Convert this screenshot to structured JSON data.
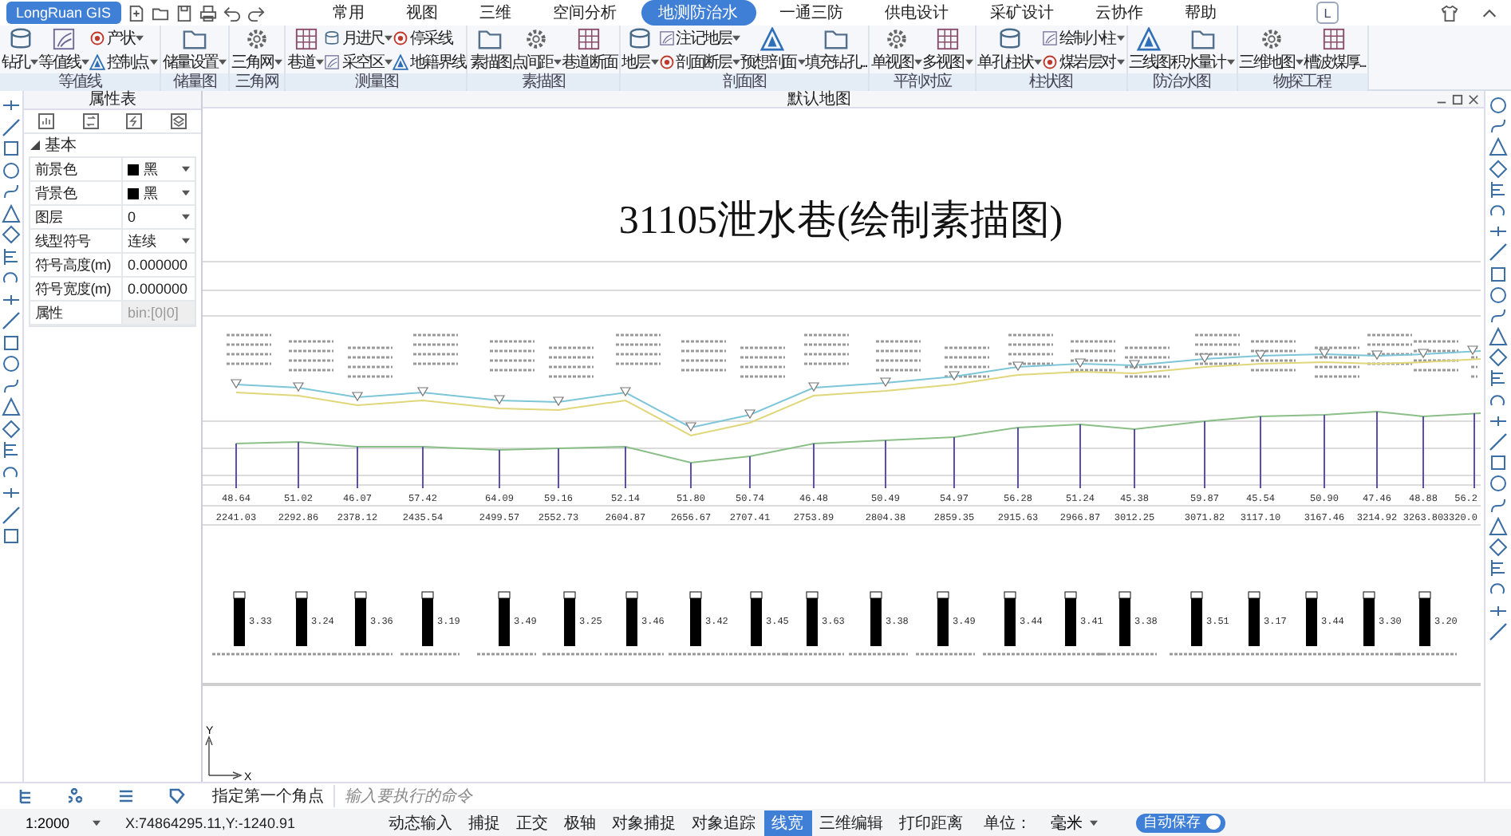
{
  "app": {
    "logo": "LongRuan GIS"
  },
  "menu": [
    {
      "label": "常用",
      "selected": false
    },
    {
      "label": "视图",
      "selected": false
    },
    {
      "label": "三维",
      "selected": false
    },
    {
      "label": "空间分析",
      "selected": false
    },
    {
      "label": "地测防治水",
      "selected": true
    },
    {
      "label": "一通三防",
      "selected": false
    },
    {
      "label": "供电设计",
      "selected": false
    },
    {
      "label": "采矿设计",
      "selected": false
    },
    {
      "label": "云协作",
      "selected": false
    },
    {
      "label": "帮助",
      "selected": false
    }
  ],
  "user": {
    "initial": "L"
  },
  "ribbon": [
    {
      "label": "等值线",
      "items": [
        {
          "kind": "large",
          "label": "钻孔",
          "dropdown": true
        },
        {
          "kind": "large",
          "label": "等值线",
          "dropdown": true
        },
        {
          "kind": "stack",
          "items": [
            {
              "label": "产状",
              "dropdown": true
            },
            {
              "label": "控制点",
              "dropdown": true
            }
          ]
        }
      ]
    },
    {
      "label": "储量图",
      "items": [
        {
          "kind": "large",
          "label": "储量设置",
          "dropdown": true
        }
      ]
    },
    {
      "label": "三角网",
      "items": [
        {
          "kind": "large",
          "label": "三角网",
          "dropdown": true
        }
      ]
    },
    {
      "label": "测量图",
      "items": [
        {
          "kind": "large",
          "label": "巷道",
          "dropdown": true
        },
        {
          "kind": "stack",
          "items": [
            {
              "label": "月进尺",
              "dropdown": true
            },
            {
              "label": "采空区",
              "dropdown": true
            }
          ]
        },
        {
          "kind": "stack",
          "items": [
            {
              "label": "停采线",
              "dropdown": false
            },
            {
              "label": "地籍界线",
              "dropdown": false
            }
          ]
        }
      ]
    },
    {
      "label": "素描图",
      "items": [
        {
          "kind": "large",
          "label": "素描图",
          "dropdown": false
        },
        {
          "kind": "large",
          "label": "点间距",
          "dropdown": true
        },
        {
          "kind": "large",
          "label": "巷道断面",
          "dropdown": false
        }
      ]
    },
    {
      "label": "剖面图",
      "items": [
        {
          "kind": "large",
          "label": "地层",
          "dropdown": true
        },
        {
          "kind": "stack",
          "items": [
            {
              "label": "注记地层",
              "dropdown": true
            },
            {
              "label": "剖面断层",
              "dropdown": true
            }
          ]
        },
        {
          "kind": "large",
          "label": "预想剖面",
          "dropdown": true
        },
        {
          "kind": "large",
          "label": "填充钻孔...",
          "dropdown": false
        }
      ]
    },
    {
      "label": "平剖对应",
      "items": [
        {
          "kind": "large",
          "label": "单视图",
          "dropdown": true
        },
        {
          "kind": "large",
          "label": "多视图",
          "dropdown": true
        }
      ]
    },
    {
      "label": "柱状图",
      "items": [
        {
          "kind": "large",
          "label": "单孔柱状",
          "dropdown": true
        },
        {
          "kind": "stack",
          "items": [
            {
              "label": "绘制小柱",
              "dropdown": true
            },
            {
              "label": "煤岩层对",
              "dropdown": true
            }
          ]
        }
      ]
    },
    {
      "label": "防治水图",
      "items": [
        {
          "kind": "large",
          "label": "三线图",
          "dropdown": false
        },
        {
          "kind": "large",
          "label": "积水量计",
          "dropdown": true
        }
      ]
    },
    {
      "label": "物探工程",
      "items": [
        {
          "kind": "large",
          "label": "三维地图",
          "dropdown": true
        },
        {
          "kind": "large",
          "label": "槽波煤厚...",
          "dropdown": false
        }
      ]
    }
  ],
  "properties": {
    "title": "属性表",
    "section": {
      "label": "基本",
      "expanded": true
    },
    "rows": [
      {
        "label": "前景色",
        "kind": "color-select",
        "value": "黑",
        "color": "#000000"
      },
      {
        "label": "背景色",
        "kind": "color-select",
        "value": "黑",
        "color": "#000000"
      },
      {
        "label": "图层",
        "kind": "select",
        "value": "0"
      },
      {
        "label": "线型符号",
        "kind": "select",
        "value": "连续"
      },
      {
        "label": "符号高度(m)",
        "kind": "input",
        "value": "0.000000"
      },
      {
        "label": "符号宽度(m)",
        "kind": "input",
        "value": "0.000000"
      },
      {
        "label": "属性",
        "kind": "readonly",
        "value": "bin:[0|0]"
      }
    ]
  },
  "canvas_tab": {
    "title": "默认地图"
  },
  "drawing": {
    "title": "31105泄水巷(绘制素描图)",
    "stations": [
      {
        "distance": "48.64",
        "mileage": "2241.03"
      },
      {
        "distance": "51.02",
        "mileage": "2292.86"
      },
      {
        "distance": "46.07",
        "mileage": "2378.12"
      },
      {
        "distance": "57.42",
        "mileage": "2435.54"
      },
      {
        "distance": "64.09",
        "mileage": "2499.57"
      },
      {
        "distance": "59.16",
        "mileage": "2552.73"
      },
      {
        "distance": "52.14",
        "mileage": "2604.87"
      },
      {
        "distance": "51.80",
        "mileage": "2656.67"
      },
      {
        "distance": "50.74",
        "mileage": "2707.41"
      },
      {
        "distance": "46.48",
        "mileage": "2753.89"
      },
      {
        "distance": "50.49",
        "mileage": "2804.38"
      },
      {
        "distance": "54.97",
        "mileage": "2859.35"
      },
      {
        "distance": "56.28",
        "mileage": "2915.63"
      },
      {
        "distance": "51.24",
        "mileage": "2966.87"
      },
      {
        "distance": "45.38",
        "mileage": "3012.25"
      },
      {
        "distance": "59.87",
        "mileage": "3071.82"
      },
      {
        "distance": "45.54",
        "mileage": "3117.10"
      },
      {
        "distance": "50.90",
        "mileage": "3167.46"
      },
      {
        "distance": "47.46",
        "mileage": "3214.92"
      },
      {
        "distance": "48.88",
        "mileage": "3263.80"
      },
      {
        "distance": "56.2",
        "mileage": "3320.0"
      }
    ],
    "columns": [
      "3.33",
      "3.24",
      "3.36",
      "3.19",
      "3.49",
      "3.25",
      "3.46",
      "3.42",
      "3.45",
      "3.63",
      "3.38",
      "3.49",
      "3.44",
      "3.41",
      "3.38",
      "3.51",
      "3.17",
      "3.44",
      "3.30",
      "3.20"
    ],
    "axis": {
      "y": "Y",
      "x": "X"
    }
  },
  "command": {
    "prompt": "指定第一个角点",
    "placeholder": "输入要执行的命令"
  },
  "status": {
    "scale": "1:2000",
    "coords": "X:74864295.11,Y:-1240.91",
    "toggles": [
      {
        "label": "动态输入",
        "on": false
      },
      {
        "label": "捕捉",
        "on": false
      },
      {
        "label": "正交",
        "on": false
      },
      {
        "label": "极轴",
        "on": false
      },
      {
        "label": "对象捕捉",
        "on": false
      },
      {
        "label": "对象追踪",
        "on": false
      },
      {
        "label": "线宽",
        "on": true
      },
      {
        "label": "三维编辑",
        "on": false
      },
      {
        "label": "打印距离",
        "on": false
      }
    ],
    "unit_label": "单位：",
    "unit": "毫米",
    "autosave": {
      "label": "自动保存",
      "on": true
    }
  }
}
